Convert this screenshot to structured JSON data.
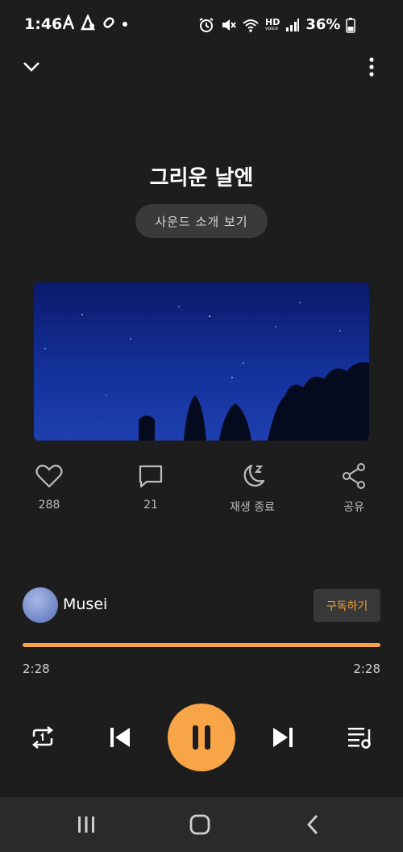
{
  "status": {
    "time": "1:46",
    "network": "HD",
    "network_sub": "voice",
    "battery": "36%"
  },
  "track": {
    "title": "그리운 날엔",
    "intro_label": "사운드 소개 보기"
  },
  "actions": {
    "like_count": "288",
    "comment_count": "21",
    "sleep_label": "재생 종료",
    "share_label": "공유"
  },
  "channel": {
    "name": "Musei",
    "subscribe_label": "구독하기"
  },
  "player": {
    "current_time": "2:28",
    "total_time": "2:28",
    "progress": 1.0
  },
  "colors": {
    "accent": "#f8a548",
    "background": "#1d1d1d"
  }
}
